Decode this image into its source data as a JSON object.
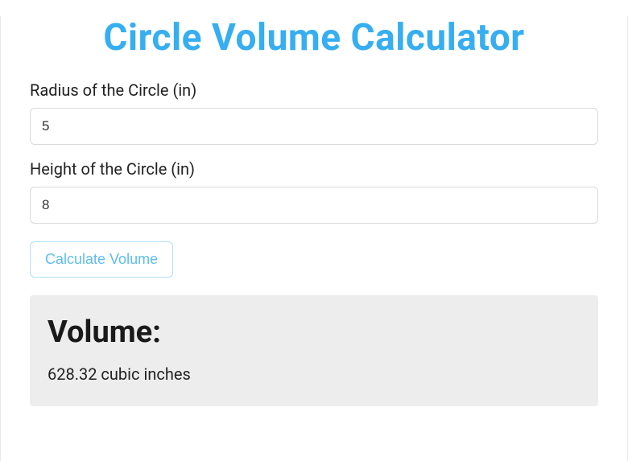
{
  "title": "Circle Volume Calculator",
  "form": {
    "radius": {
      "label": "Radius of the Circle (in)",
      "value": "5"
    },
    "height": {
      "label": "Height of the Circle (in)",
      "value": "8"
    },
    "submit_label": "Calculate Volume"
  },
  "result": {
    "heading": "Volume:",
    "value": "628.32 cubic inches"
  }
}
